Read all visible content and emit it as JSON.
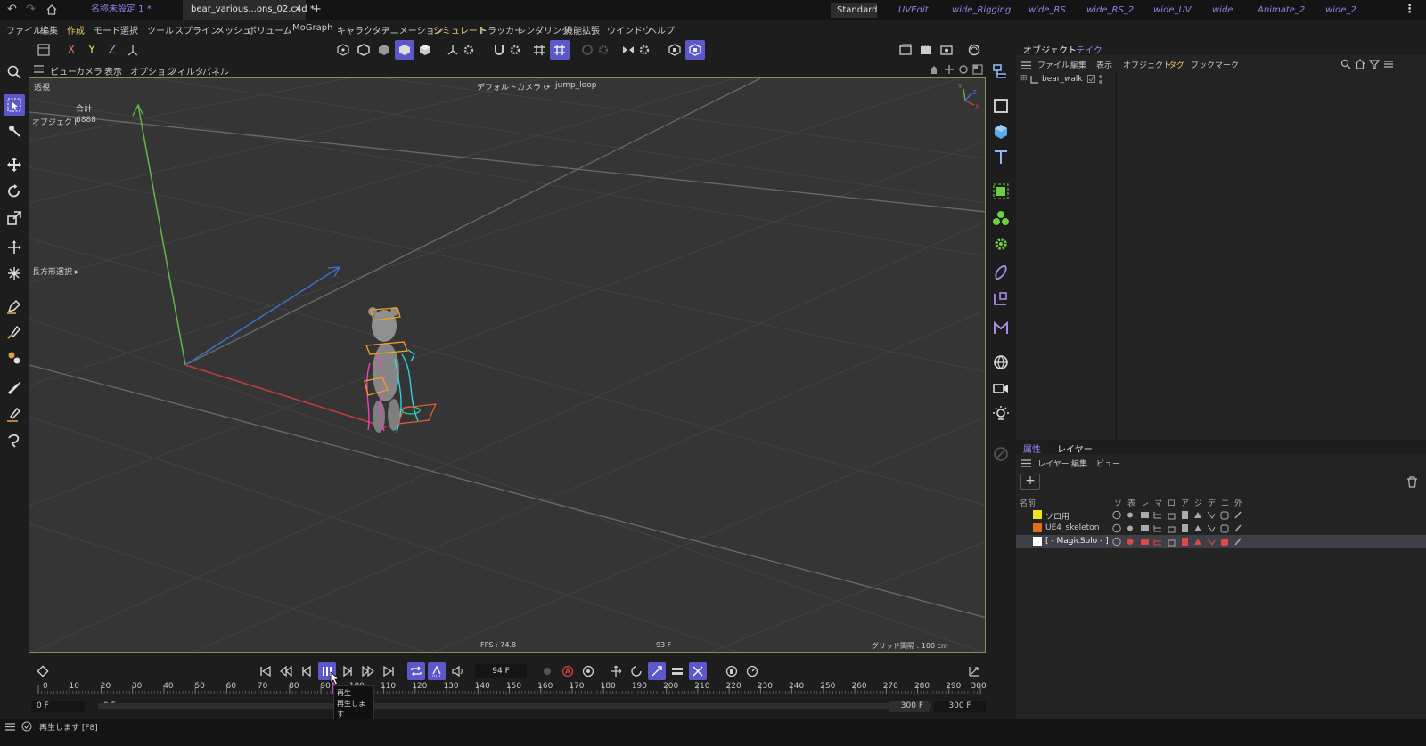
{
  "tabs": {
    "undo": "↶",
    "redo": "↷",
    "doc1": "名称未設定 1 *",
    "doc2": "bear_various...ons_02.c4d *",
    "close": "×",
    "add": "+",
    "more": "⋮"
  },
  "workspaces": [
    "Standard",
    "UVEdit",
    "wide_Rigging",
    "wide_RS",
    "wide_RS_2",
    "wide_UV",
    "wide",
    "Animate_2",
    "wide_2"
  ],
  "menu": [
    "ファイル",
    "編集",
    "作成",
    "モード",
    "選択",
    "ツール",
    "スプライン",
    "メッシュ",
    "ボリューム",
    "MoGraph",
    "キャラクター",
    "アニメーション",
    "シミュレート",
    "トラッカー",
    "レンダリング",
    "機能拡張",
    "ウインドウ",
    "ヘルプ"
  ],
  "axes_toolbar": {
    "x": "X",
    "y": "Y",
    "z": "Z"
  },
  "viewport_menu": [
    "ビュー",
    "カメラ",
    "表示",
    "オプション",
    "フィルタ",
    "パネル"
  ],
  "viewport": {
    "view_name": "透視",
    "camera": "デフォルトカメラ ⟳",
    "take": "jump_loop",
    "stats_header": "合計",
    "stats_label": "オブジェクト",
    "stats_value": "6888",
    "selection_tool": "長方形選択 ▸",
    "fps": "FPS : 74.8",
    "frame": "93 F",
    "grid_spacing": "グリッド間隔 : 100 cm",
    "axis_y": "Y",
    "axis_x": "X",
    "axis_z": "Z"
  },
  "object_panel": {
    "tabs": [
      "オブジェクト",
      "テイク"
    ],
    "menu": [
      "ファイル",
      "編集",
      "表示",
      "オブジェクト",
      "タグ",
      "ブックマーク"
    ],
    "objects": [
      {
        "name": "bear_walk"
      }
    ]
  },
  "layer_panel": {
    "tabs": [
      "属性",
      "レイヤー"
    ],
    "menu": [
      "レイヤー",
      "編集",
      "ビュー"
    ],
    "add": "+",
    "columns": {
      "name": "名前",
      "flags": [
        "ソ",
        "表",
        "レ",
        "マ",
        "ロ",
        "ア",
        "ジ",
        "デ",
        "エ",
        "外"
      ]
    },
    "rows": [
      {
        "name": "ソロ用",
        "color": "#f1e615"
      },
      {
        "name": "UE4_skeleton",
        "color": "#e07020"
      },
      {
        "name": "[ - MagicSolo - ]",
        "color": "#ffffff"
      }
    ]
  },
  "timeline": {
    "current_frame": "94 F",
    "ruler_labels": [
      "0",
      "10",
      "20",
      "30",
      "40",
      "50",
      "60",
      "70",
      "80",
      "90",
      "100",
      "110",
      "120",
      "130",
      "140",
      "150",
      "160",
      "170",
      "180",
      "190",
      "200",
      "210",
      "220",
      "230",
      "240",
      "250",
      "260",
      "270",
      "280",
      "290",
      "300"
    ],
    "range_start": "0 F",
    "range_start2": "0 F",
    "range_end": "300 F",
    "range_end2": "300 F",
    "tooltip": {
      "title": "再生",
      "desc": "再生します",
      "key": "[F8]"
    }
  },
  "status": {
    "text": "再生します [F8]"
  },
  "colors": {
    "accent": "#5d58c9",
    "workspace_link": "#8f86ea",
    "viewport_bg": "#353535"
  }
}
